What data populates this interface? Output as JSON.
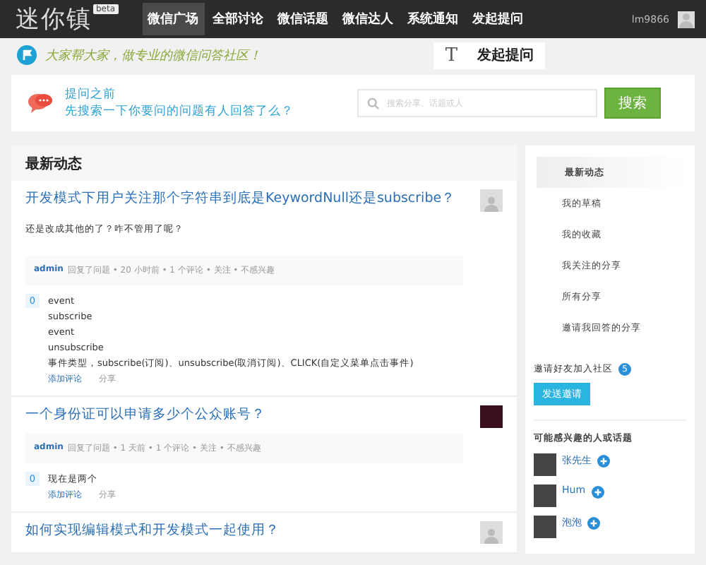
{
  "header": {
    "logo": "迷你镇",
    "beta": "beta",
    "nav": [
      {
        "label": "微信广场",
        "selected": true
      },
      {
        "label": "全部讨论",
        "selected": false
      },
      {
        "label": "微信话题",
        "selected": false
      },
      {
        "label": "微信达人",
        "selected": false
      },
      {
        "label": "系统通知",
        "selected": false
      },
      {
        "label": "发起提问",
        "selected": false
      }
    ],
    "username": "lm9866"
  },
  "slogan": "大家帮大家，做专业的微信问答社区！",
  "ask_button": {
    "icon": "T",
    "label": "发起提问"
  },
  "search_card": {
    "line1": "提问之前",
    "line2": "先搜索一下你要问的问题有人回答了么？",
    "placeholder": "搜索分享、话题或人",
    "button": "搜索"
  },
  "feed": {
    "title": "最新动态",
    "items": [
      {
        "title": "开发模式下用户关注那个字符串到底是KeywordNull还是subscribe？",
        "excerpt": "还是改成其他的了？咋不管用了呢？",
        "kind": "default",
        "meta_user": "admin",
        "meta": "回复了问题 • 20 小时前 • 1 个评论 • 关注 • 不感兴趣",
        "votes": "0",
        "answer": [
          "event",
          "subscribe",
          "event",
          "unsubscribe",
          "事件类型，subscribe(订阅)、unsubscribe(取消订阅)、CLICK(自定义菜单点击事件)"
        ],
        "actions": [
          "添加评论",
          "分享"
        ]
      },
      {
        "title": "一个身份证可以申请多少个公众账号？",
        "kind": "photo",
        "meta_user": "admin",
        "meta": "回复了问题 • 1 天前 • 1 个评论 • 关注 • 不感兴趣",
        "votes": "0",
        "answer": [
          "现在是两个"
        ],
        "actions": [
          "添加评论",
          "分享"
        ]
      },
      {
        "title": "如何实现编辑模式和开发模式一起使用？",
        "kind": "default"
      }
    ]
  },
  "sidebar": {
    "nav": [
      {
        "label": "最新动态",
        "selected": true
      },
      {
        "label": "我的草稿",
        "selected": false
      },
      {
        "label": "我的收藏",
        "selected": false
      },
      {
        "label": "我关注的分享",
        "selected": false
      },
      {
        "label": "所有分享",
        "selected": false
      },
      {
        "label": "邀请我回答的分享",
        "selected": false
      }
    ],
    "invite": {
      "text": "邀请好友加入社区",
      "count": "5",
      "button": "发送邀请"
    },
    "suggest_title": "可能感兴趣的人或话题",
    "people": [
      {
        "name": "张先生"
      },
      {
        "name": "Hum"
      },
      {
        "name": "泡泡"
      }
    ]
  }
}
